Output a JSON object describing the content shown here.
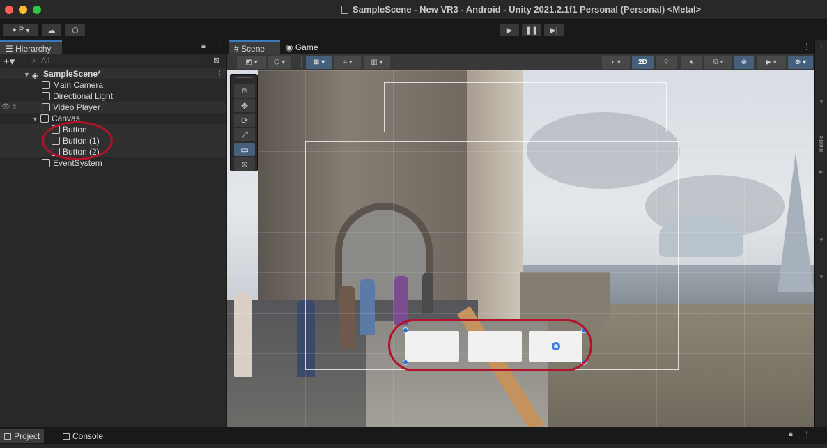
{
  "window": {
    "title": "SampleScene - New VR3 - Android - Unity 2021.2.1f1 Personal (Personal) <Metal>"
  },
  "toolbar": {
    "account_label": "P",
    "play_icon": "play-icon",
    "pause_icon": "pause-icon",
    "step_icon": "step-icon"
  },
  "hierarchy": {
    "tab_label": "Hierarchy",
    "search_placeholder": "All",
    "scene_name": "SampleScene*",
    "items": [
      {
        "label": "Main Camera",
        "depth": 1
      },
      {
        "label": "Directional Light",
        "depth": 1
      },
      {
        "label": "Video Player",
        "depth": 1
      },
      {
        "label": "Canvas",
        "depth": 1
      },
      {
        "label": "Button",
        "depth": 2
      },
      {
        "label": "Button (1)",
        "depth": 2
      },
      {
        "label": "Button (2)",
        "depth": 2
      },
      {
        "label": "EventSystem",
        "depth": 1
      }
    ]
  },
  "scene": {
    "tabs": [
      {
        "label": "Scene"
      },
      {
        "label": "Game"
      }
    ],
    "toolbar": {
      "mode_2d_label": "2D"
    },
    "right_strip_label": "middle"
  },
  "bottom": {
    "tabs": [
      {
        "label": "Project"
      },
      {
        "label": "Console"
      }
    ]
  },
  "colors": {
    "highlight": "#b4122a",
    "accent": "#3a79bb",
    "active_tool": "#46607c"
  }
}
